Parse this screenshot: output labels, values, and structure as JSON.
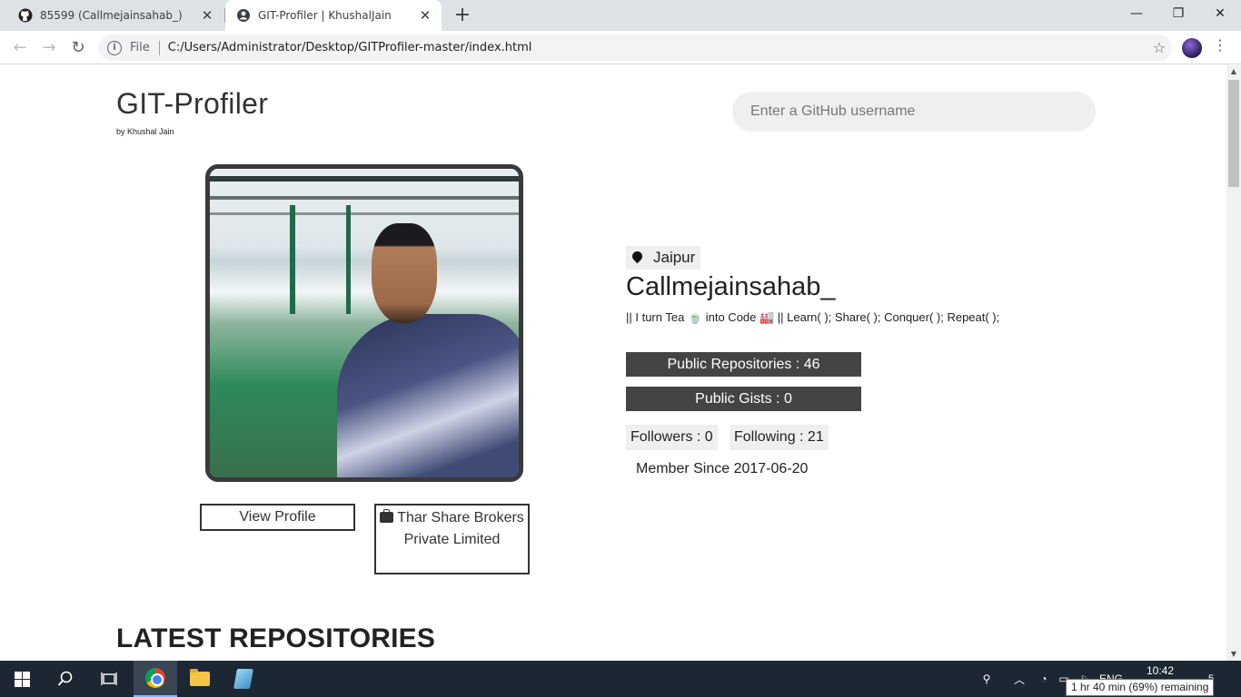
{
  "browser": {
    "tabs": [
      {
        "title": "85599 (Callmejainsahab_)",
        "favicon": "github-icon"
      },
      {
        "title": "GIT-Profiler | KhushalJain",
        "favicon": "globe-icon"
      }
    ],
    "address": {
      "scheme_label": "File",
      "url": "C:/Users/Administrator/Desktop/GITProfiler-master/index.html"
    }
  },
  "page": {
    "brand": {
      "title": "GIT-Profiler",
      "subtitle": "by Khushal Jain"
    },
    "search": {
      "placeholder": "Enter a GitHub username",
      "value": ""
    },
    "profile": {
      "location": "Jaipur",
      "username": "Callmejainsahab_",
      "bio": "|| I turn Tea 🍵 into Code 🏭 || Learn( ); Share( ); Conquer( ); Repeat( );",
      "public_repos": "Public Repositories : 46",
      "public_gists": "Public Gists : 0",
      "followers": "Followers : 0",
      "following": "Following : 21",
      "member_since": "Member Since 2017-06-20",
      "view_profile_label": "View Profile",
      "company": "Thar Share Brokers Private Limited"
    },
    "latest_repos_heading": "LATEST REPOSITORIES"
  },
  "taskbar": {
    "clock": "10:42",
    "language": "ENG",
    "battery_tooltip": "1 hr 40 min (69%) remaining",
    "notification_count": "5"
  },
  "colors": {
    "stat_bar": "#444444",
    "chip_bg": "#efefef",
    "taskbar": "#1c2733"
  }
}
